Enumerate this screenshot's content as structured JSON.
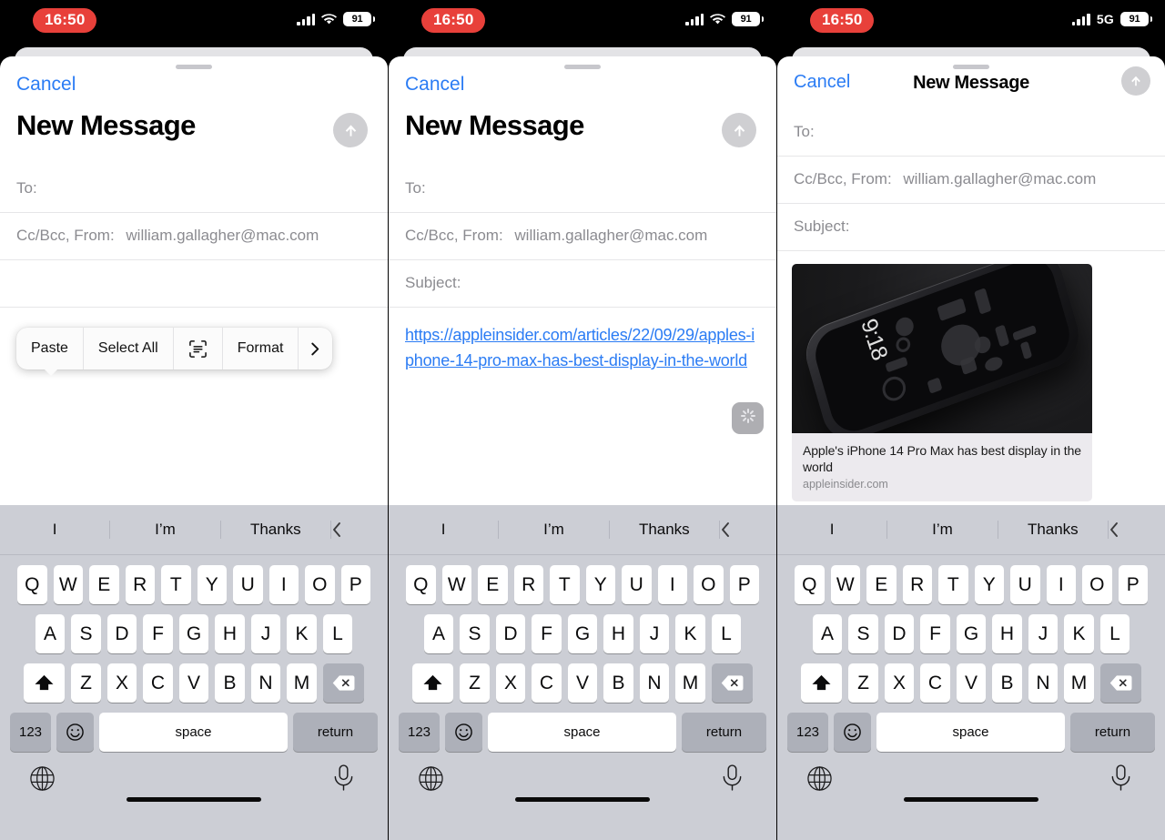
{
  "status_bar": {
    "time": "16:50",
    "battery": "91",
    "network_label_p3": "5G",
    "signal_icon": "cellular-signal-icon",
    "wifi_icon": "wifi-icon",
    "battery_icon": "battery-icon"
  },
  "compose": {
    "cancel_label": "Cancel",
    "title": "New Message",
    "send_icon": "send-arrow-up-icon",
    "to_label": "To:",
    "ccbcc_label": "Cc/Bcc, From:",
    "from_value": "william.gallagher@mac.com",
    "subject_label": "Subject:",
    "body_url": "https://appleinsider.com/articles/22/09/29/apples-iphone-14-pro-max-has-best-display-in-the-world",
    "spinner_icon": "loading-spinner-icon"
  },
  "context_menu": {
    "items": [
      {
        "label": "Paste",
        "icon": null
      },
      {
        "label": "Select All",
        "icon": null
      },
      {
        "label": "",
        "icon": "scan-text-icon"
      },
      {
        "label": "Format",
        "icon": null
      },
      {
        "label": "›",
        "icon": "chevron-right-icon"
      }
    ]
  },
  "link_preview": {
    "title": "Apple's iPhone 14 Pro Max has best display in the world",
    "domain": "appleinsider.com",
    "image_alt": "black-iphone-on-dark-surface-photo",
    "wallpaper_time": "9:18"
  },
  "keyboard": {
    "predictions": [
      "I",
      "I’m",
      "Thanks"
    ],
    "collapse_icon": "chevron-left-icon",
    "row1": [
      "Q",
      "W",
      "E",
      "R",
      "T",
      "Y",
      "U",
      "I",
      "O",
      "P"
    ],
    "row2": [
      "A",
      "S",
      "D",
      "F",
      "G",
      "H",
      "J",
      "K",
      "L"
    ],
    "row3": [
      "Z",
      "X",
      "C",
      "V",
      "B",
      "N",
      "M"
    ],
    "shift_icon": "shift-arrow-up-icon",
    "delete_icon": "delete-backspace-icon",
    "numbers_label": "123",
    "emoji_icon": "emoji-smiley-icon",
    "space_label": "space",
    "return_label": "return",
    "globe_icon": "globe-language-icon",
    "mic_icon": "microphone-dictation-icon"
  },
  "colors": {
    "accent_blue": "#2b7cf4",
    "time_pill_red": "#e8403a",
    "keyboard_bg": "#ccced5",
    "key_special": "#adb0b9",
    "send_disabled": "#cfcfd2"
  }
}
